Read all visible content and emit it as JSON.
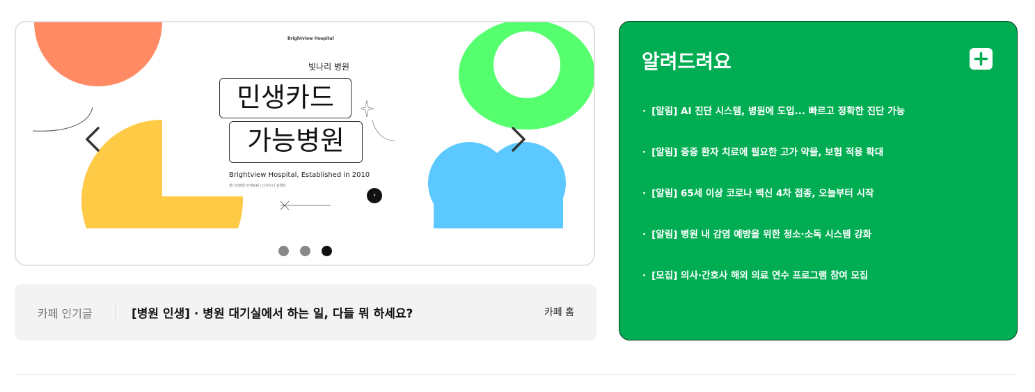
{
  "banner": {
    "hospital_en": "Brightview Hospital",
    "hospital_ko": "빛나리 병원",
    "line1": "민생카드",
    "line2": "가능병원",
    "established": "Brightview Hospital, Established in 2010",
    "small_text": "빛나리병원 마케팅팀 | 디자이너 김해피",
    "next_glyph": "›",
    "slide_count": 3,
    "active_slide": 3
  },
  "cafe": {
    "label": "카페 인기글",
    "post": "[병원 인생] · 병원 대기실에서 하는 일, 다들 뭐 하세요?",
    "home_link": "카페 홈"
  },
  "notice": {
    "title": "알려드려요",
    "bullet": "·",
    "items": [
      "[알림] AI 진단 시스템, 병원에 도입... 빠르고 정확한 진단 가능",
      "[알림] 중증 환자 치료에 필요한 고가 약물, 보험 적용 확대",
      "[알림] 65세 이상 코로나 백신 4차 접종, 오늘부터 시작",
      "[알림] 병원 내 감염 예방을 위한 청소·소독 시스템 강화",
      "[모집] 의사·간호사 해외 의료 연수 프로그램 참여 모집"
    ],
    "colors": {
      "background": "#00ad52",
      "text": "#ffffff"
    }
  },
  "icons": {
    "prev": "chevron-left-icon",
    "next": "chevron-right-icon",
    "more": "plus-icon"
  }
}
